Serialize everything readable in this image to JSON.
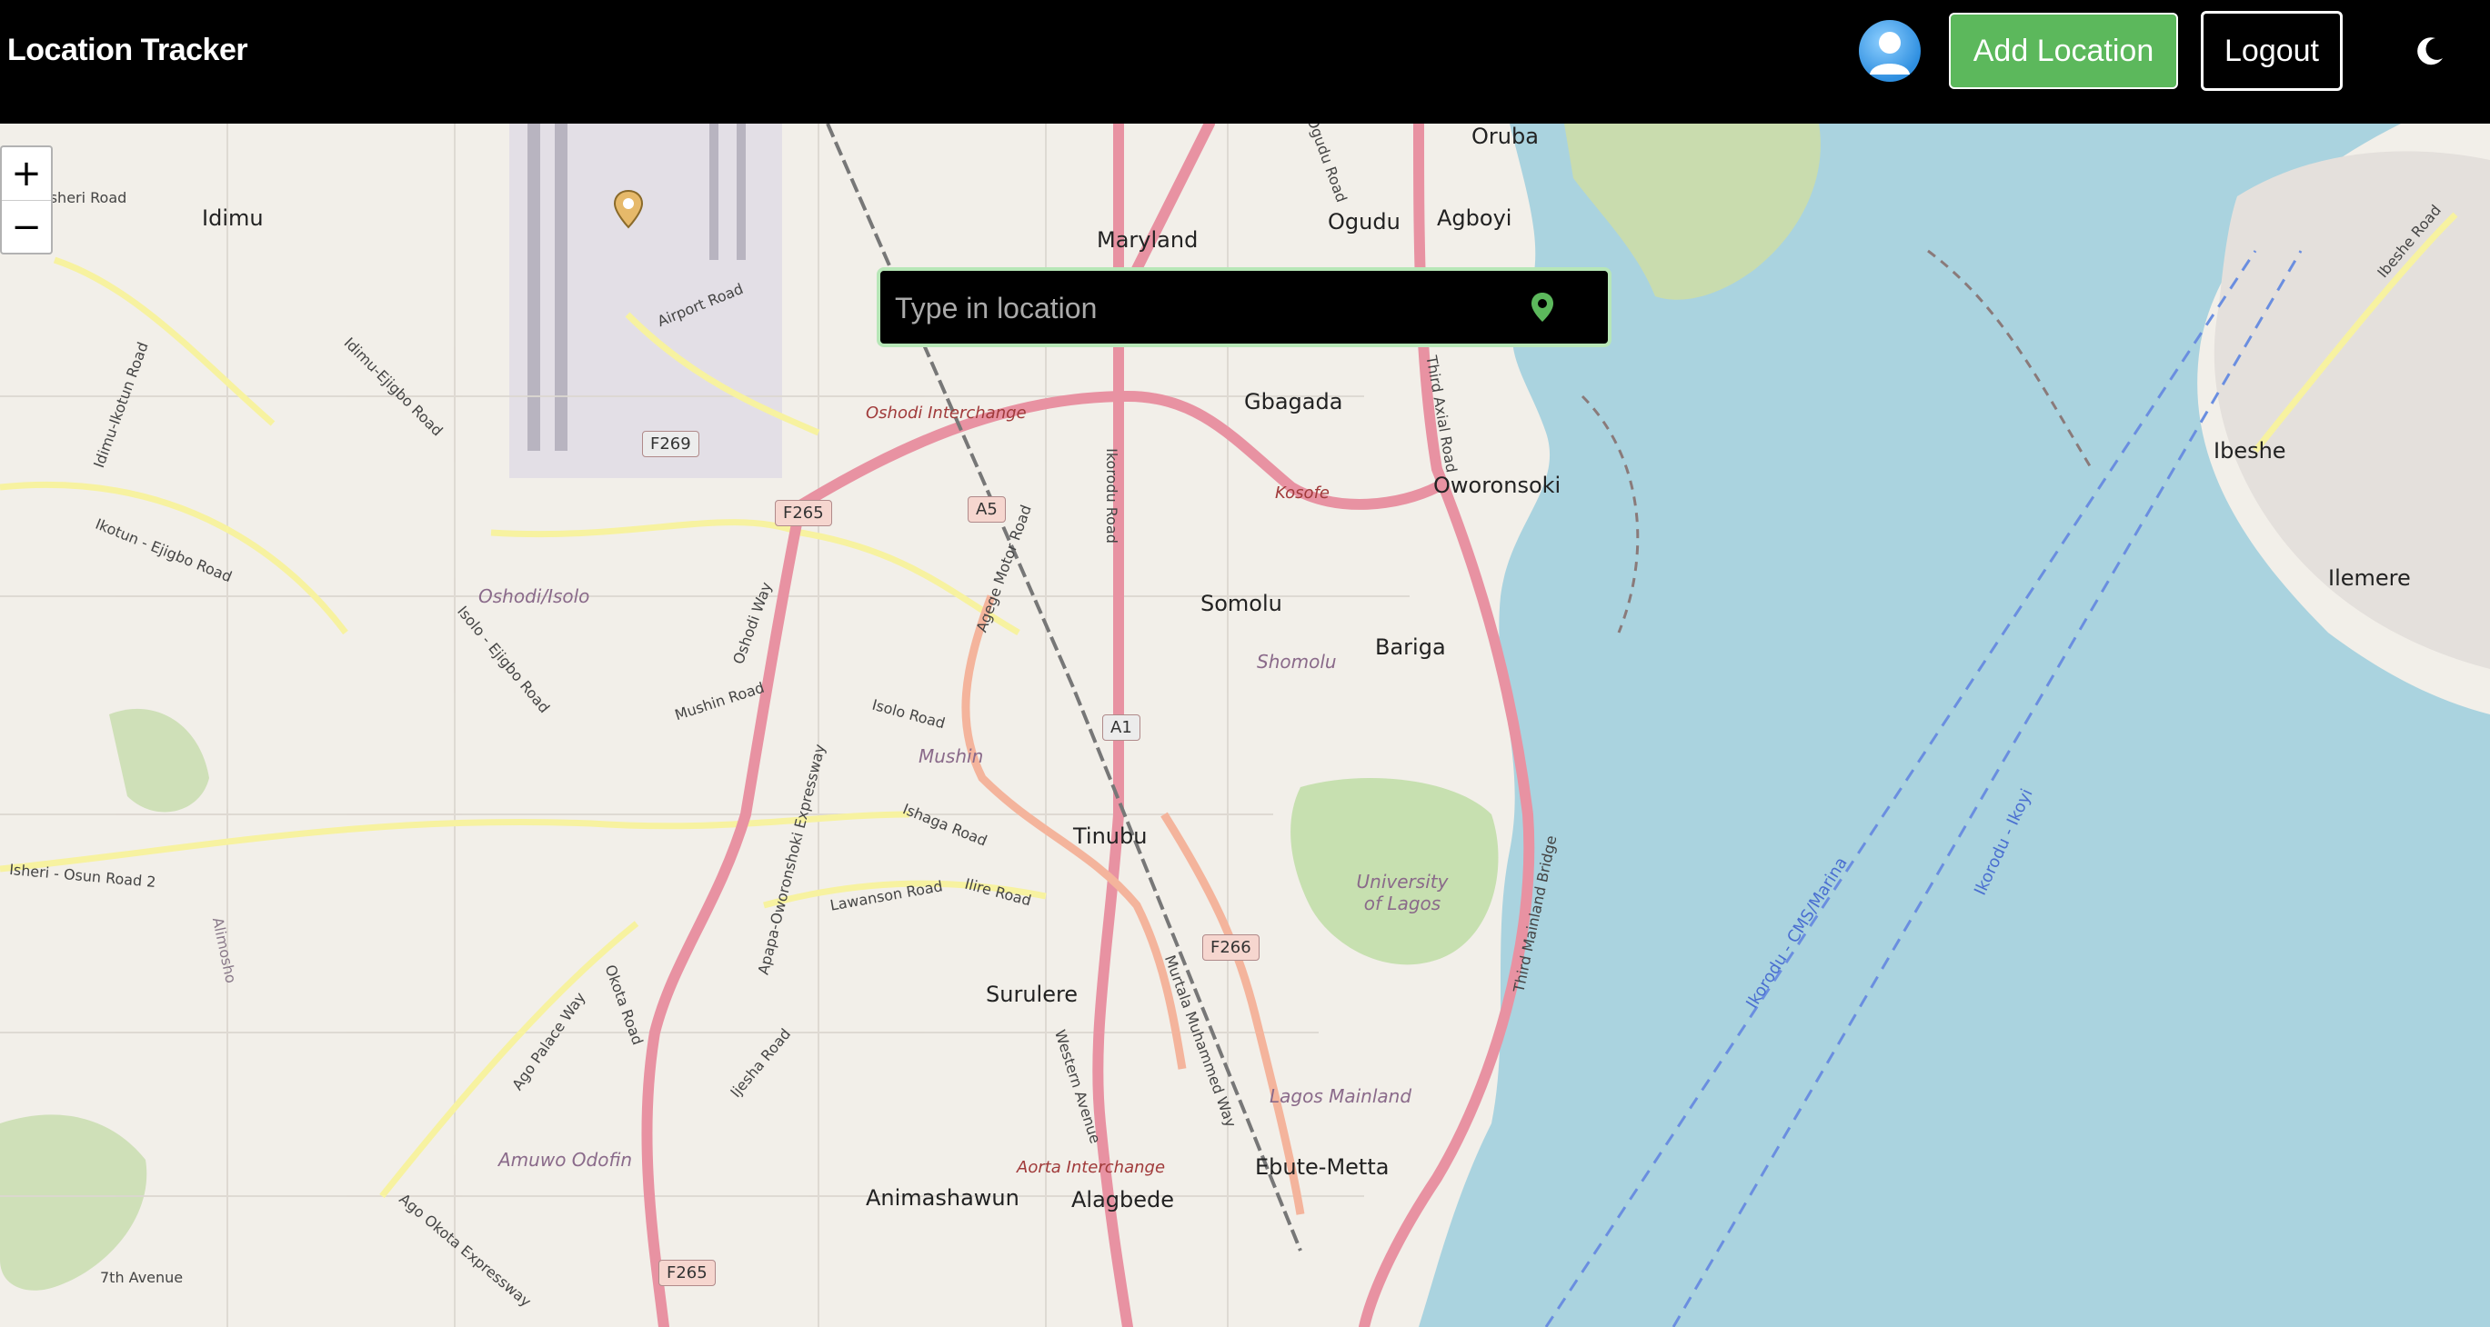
{
  "app": {
    "title": "Location Tracker",
    "add_location_label": "Add Location",
    "logout_label": "Logout"
  },
  "icons": {
    "avatar": "user-avatar-icon",
    "theme": "moon-icon",
    "pin": "map-pin-icon"
  },
  "colors": {
    "navbar": "#000000",
    "accent_green": "#5cb85c",
    "water": "#aad3df",
    "land": "#f2efe9",
    "highway": "#e892a2"
  },
  "search": {
    "placeholder": "Type in location",
    "value": ""
  },
  "zoom": {
    "in": "+",
    "out": "−"
  },
  "map_labels": {
    "places": [
      "Idimu",
      "Maryland",
      "Ogudu",
      "Agboyi",
      "Oruba",
      "Gbagada",
      "Oworonsoki",
      "Somolu",
      "Bariga",
      "Tinubu",
      "Surulere",
      "Ebute-Metta",
      "Animashawun",
      "Alagbede",
      "Ibeshe",
      "Ilemere"
    ],
    "areas": [
      "Oshodi/Isolo",
      "Shomolu",
      "Mushin",
      "University of Lagos",
      "Lagos Mainland",
      "Amuwo Odofin",
      "Oshodi Interchange",
      "Aorta Interchange",
      "Kosofe"
    ],
    "roads": [
      "Isheri Road",
      "Airport Road",
      "Idimu-Ikotun Road",
      "Idimu-Ejigbo Road",
      "Ikotun - Ejigbo Road",
      "Isolo - Ejigbo Road",
      "Mushin Road",
      "Isolo Road",
      "Oshodi Way",
      "Apapa-Oworonshoki Expressway",
      "Isheri - Osun Road 2",
      "Okota Road",
      "Ago Palace Way",
      "Ijesha Road",
      "Lawanson Road",
      "Ilire Road",
      "Ishaga Road",
      "Agege Motor Road",
      "Ikorodu Road",
      "Third Axial Road",
      "Third Mainland Bridge",
      "Murtala Muhammed Way",
      "Western Avenue",
      "7th Avenue",
      "Ago Okota Expressway",
      "Alimosho",
      "Ogudu Road",
      "Ibeshe Road"
    ],
    "water": [
      "Ikorodu - CMS/Marina",
      "Ikorodu - Ikoyi"
    ],
    "shields": [
      "F269",
      "F265",
      "A5",
      "A1",
      "F266",
      "F265"
    ]
  }
}
